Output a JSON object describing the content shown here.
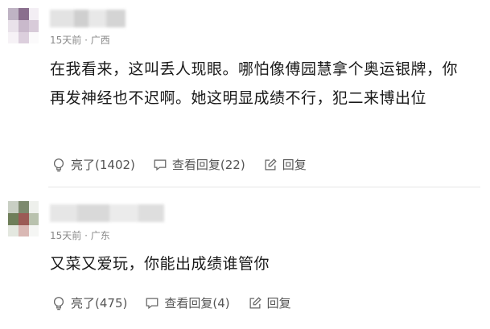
{
  "comments": [
    {
      "time": "15天前",
      "separator": "·",
      "location": "广西",
      "text": "在我看来，这叫丢人现眼。哪怕像傅园慧拿个奥运银牌，你再发神经也不迟啊。她这明显成绩不行，犯二来博出位",
      "like_label": "亮了(1402)",
      "reply_label": "查看回复(22)",
      "respond_label": "回复"
    },
    {
      "time": "15天前",
      "separator": "·",
      "location": "广东",
      "text": "又菜又爱玩，你能出成绩谁管你",
      "like_label": "亮了(475)",
      "reply_label": "查看回复(4)",
      "respond_label": "回复"
    }
  ],
  "colors": {
    "text_primary": "#1a1a1a",
    "text_meta": "#8a8a8a",
    "action_text": "#555555",
    "divider": "#e6e6e6"
  },
  "icons": {
    "like": "lightbulb-icon",
    "view_replies": "speech-bubble-icon",
    "reply": "edit-pencil-icon"
  }
}
